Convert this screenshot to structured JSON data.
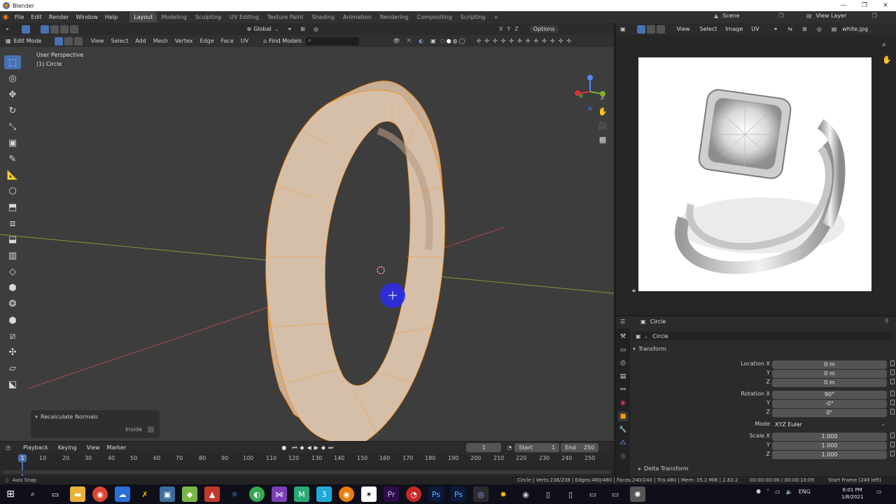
{
  "window": {
    "title": "Blender"
  },
  "menu": {
    "items": [
      "File",
      "Edit",
      "Render",
      "Window",
      "Help"
    ]
  },
  "workspaces": {
    "tabs": [
      "Layout",
      "Modeling",
      "Sculpting",
      "UV Editing",
      "Texture Paint",
      "Shading",
      "Animation",
      "Rendering",
      "Compositing",
      "Scripting"
    ],
    "active": "Layout",
    "add": "+"
  },
  "scene": {
    "name": "Scene",
    "view_layer": "View Layer"
  },
  "viewport": {
    "transform_orientation": "Global",
    "options_label": "Options",
    "mode": "Edit Mode",
    "header_menus": [
      "View",
      "Select",
      "Add",
      "Mesh",
      "Vertex",
      "Edge",
      "Face",
      "UV"
    ],
    "find_models": "Find Models",
    "axis_labels": [
      "X",
      "Y",
      "Z"
    ],
    "overlay_title": "User Perspective",
    "overlay_object": "(1) Circle"
  },
  "redo_panel": {
    "title": "Recalculate Normals",
    "inside_label": "Inside"
  },
  "timeline": {
    "menus": [
      "Playback",
      "Keying",
      "View",
      "Marker"
    ],
    "current_frame": "1",
    "start_label": "Start",
    "start": "1",
    "end_label": "End",
    "end": "250",
    "ticks": [
      "10",
      "20",
      "30",
      "40",
      "50",
      "60",
      "70",
      "80",
      "90",
      "100",
      "110",
      "120",
      "130",
      "140",
      "150",
      "160",
      "170",
      "180",
      "190",
      "200",
      "210",
      "220",
      "230",
      "240",
      "250"
    ],
    "playhead": "1"
  },
  "image_editor": {
    "menus": [
      "View",
      "Select",
      "Image",
      "UV"
    ],
    "image_name": "white.jpg"
  },
  "properties": {
    "object_name": "Circle",
    "data_name": "Circle",
    "panel_transform": "Transform",
    "location": {
      "label": "Location X",
      "x": "0 m",
      "y": "0 m",
      "z": "0 m"
    },
    "rotation": {
      "label": "Rotation X",
      "x": "90°",
      "y": "-0°",
      "z": "0°"
    },
    "mode_label": "Mode",
    "mode_value": "XYZ Euler",
    "scale": {
      "label": "Scale X",
      "x": "1.000",
      "y": "1.000",
      "z": "1.000"
    },
    "axis_y": "Y",
    "axis_z": "Z",
    "panel_delta": "Delta Transform"
  },
  "statusbar": {
    "left": "Axis Snap",
    "stats": "Circle | Verts:238/238 | Edges:480/480 | Faces:240/240 | Tris:480 | Mem: 35.2 MiB | 2.83.2",
    "time": "00:00:00:00 / 00:00:10:09",
    "start_frame": "Start Frame (249 left)"
  },
  "taskbar": {
    "time": "6:01 PM",
    "date": "1/8/2021",
    "lang": "ENG"
  },
  "colors": {
    "accent": "#4772b3",
    "ring_fill": "#cdb5a0",
    "vertex": "#ff8a00",
    "axis_x": "#b24949",
    "axis_y": "#7a9a36"
  }
}
